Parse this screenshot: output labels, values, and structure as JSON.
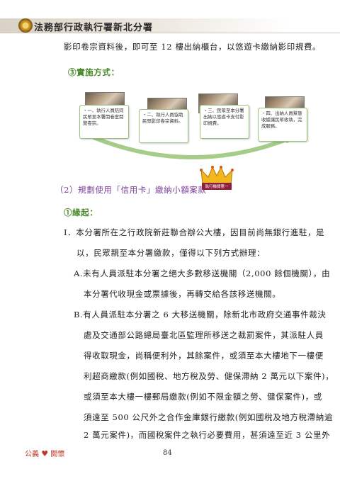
{
  "header": {
    "title": "法務部行政執行署新北分署"
  },
  "body_lines": [
    "影印卷宗資料後，即可至 12 樓出納櫃台，以悠遊卡繳納影印規費。"
  ],
  "section3": {
    "heading": "③實施方式："
  },
  "flow_steps": [
    "・一、執行人員陪同民眾至本署閱卷室閱覽卷宗。",
    "・二、執行人員協助民眾影印卷宗資料。",
    "・三、民眾至本分署出納以悠遊卡支付影印規費。",
    "・四、出納人員幫發收據讓民眾收執，完成服務。"
  ],
  "section2": {
    "heading": "（2）規劃使用「信用卡」繳納小額案款",
    "crown_text": "執行機關第一"
  },
  "reason": {
    "heading": "①緣起："
  },
  "paragraph": [
    "I．本分署所在之行政院新莊聯合辦公大樓，因目前尚無銀行進駐，是",
    "以，民眾親至本分署繳款，僅得以下列方式辦理：",
    "A.未有人員派駐本分署之絕大多數移送機關（2,000 餘個機關），由",
    "本分署代收現金或票據後，再轉交給各該移送機關。",
    "B.有人員派駐本分署之 6 大移送機關，除新北市政府交通事件裁決",
    "處及交通部公路總局臺北區監理所移送之裁罰案件，其派駐人員",
    "得收取現金，尚稱便利外，其餘案件，或須至本大樓地下一樓便",
    "利超商繳款(例如國稅、地方稅及勞、健保滯納 2 萬元以下案件)，",
    "或須至本大樓一樓郵局繳款(例如不限金額之勞、健保案件)，或",
    "須遠至 500 公尺外之合作金庫銀行繳款(例如國稅及地方稅滯納逾",
    "2 萬元案件)，而國稅案件之執行必要費用，甚須遠至近 3 公里外"
  ],
  "footer": {
    "left_a": "公義",
    "left_b": "關懷",
    "page_number": "84"
  }
}
